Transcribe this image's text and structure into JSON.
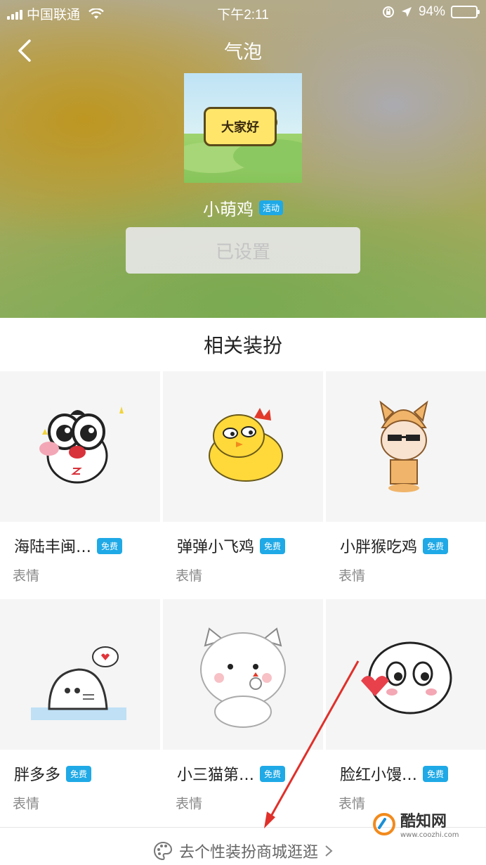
{
  "status_bar": {
    "carrier": "中国联通",
    "time": "下午2:11",
    "battery_percent": "94%",
    "battery_level": 0.94
  },
  "nav": {
    "title": "气泡"
  },
  "item": {
    "preview_text": "大家好",
    "name": "小萌鸡",
    "tag": "活动",
    "button_label": "已设置"
  },
  "related": {
    "title": "相关装扮",
    "cards": [
      {
        "name": "海陆丰闽…",
        "tag": "免费",
        "type": "表情",
        "icon": "panda-sticker-icon"
      },
      {
        "name": "弹弹小飞鸡",
        "tag": "免费",
        "type": "表情",
        "icon": "chick-sticker-icon"
      },
      {
        "name": "小胖猴吃鸡",
        "tag": "免费",
        "type": "表情",
        "icon": "dog-hat-sticker-icon"
      },
      {
        "name": "胖多多",
        "tag": "免费",
        "type": "表情",
        "icon": "seal-sticker-icon"
      },
      {
        "name": "小三猫第…",
        "tag": "免费",
        "type": "表情",
        "icon": "cat-sticker-icon"
      },
      {
        "name": "脸红小馒…",
        "tag": "免费",
        "type": "表情",
        "icon": "bun-sticker-icon"
      }
    ]
  },
  "footer": {
    "link_label": "去个性装扮商城逛逛"
  },
  "watermark": {
    "title": "酷知网",
    "url": "www.coozhi.com"
  },
  "colors": {
    "accent_blue": "#1fa9e6",
    "arrow_red": "#e0302a"
  }
}
